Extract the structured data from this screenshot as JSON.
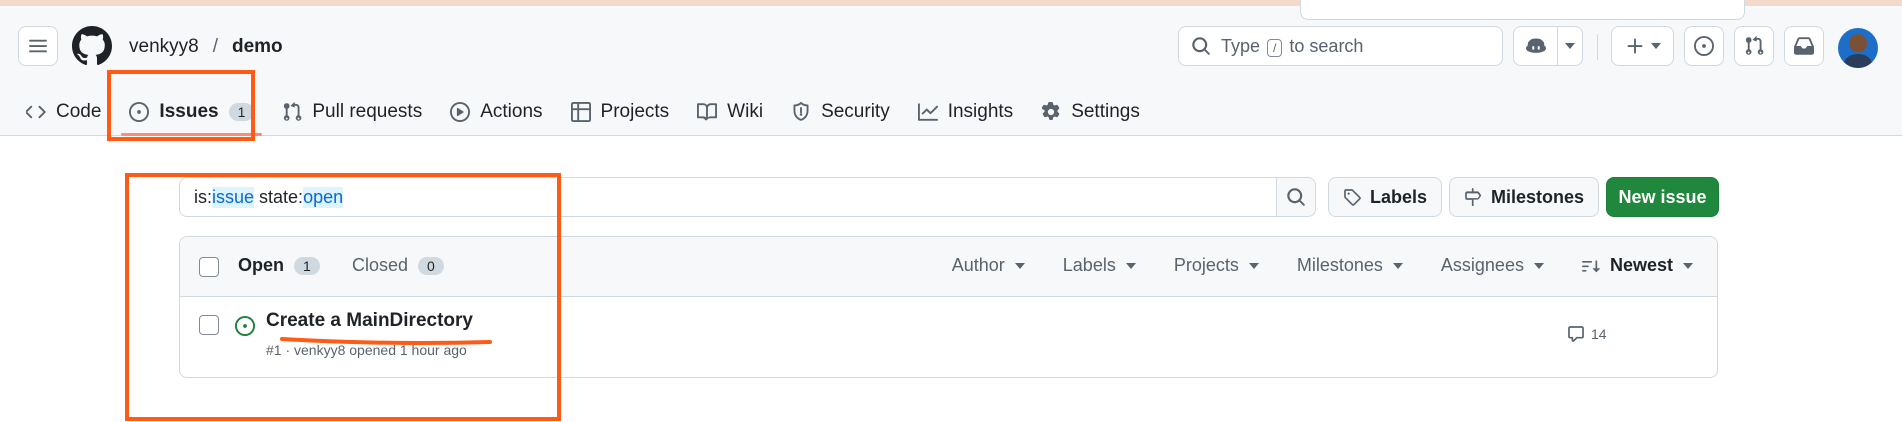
{
  "header": {
    "owner": "venkyy8",
    "separator": "/",
    "repo": "demo",
    "search": {
      "prefix": "Type",
      "key": "/",
      "suffix": "to search"
    }
  },
  "tabs": [
    {
      "label": "Code",
      "icon": "code-icon"
    },
    {
      "label": "Issues",
      "icon": "issue-opened-icon",
      "count": "1",
      "active": true
    },
    {
      "label": "Pull requests",
      "icon": "git-pull-request-icon"
    },
    {
      "label": "Actions",
      "icon": "play-icon"
    },
    {
      "label": "Projects",
      "icon": "table-icon"
    },
    {
      "label": "Wiki",
      "icon": "book-icon"
    },
    {
      "label": "Security",
      "icon": "shield-icon"
    },
    {
      "label": "Insights",
      "icon": "graph-icon"
    },
    {
      "label": "Settings",
      "icon": "gear-icon"
    }
  ],
  "filter": {
    "query_prefix": "is:",
    "query_token1": "issue",
    "query_mid": " state:",
    "query_token2": "open"
  },
  "buttons": {
    "labels": "Labels",
    "milestones": "Milestones",
    "new_issue": "New issue"
  },
  "list": {
    "open_label": "Open",
    "open_count": "1",
    "closed_label": "Closed",
    "closed_count": "0",
    "filters": [
      "Author",
      "Labels",
      "Projects",
      "Milestones",
      "Assignees"
    ],
    "sort_label": "Newest",
    "issues": [
      {
        "title": "Create a MainDirectory",
        "meta": "#1 · venkyy8 opened 1 hour ago",
        "comments": "14"
      }
    ]
  },
  "colors": {
    "accent": "#ff5b14",
    "primary": "#1f883d",
    "open_state": "#1a7f37",
    "link": "#0969da"
  }
}
